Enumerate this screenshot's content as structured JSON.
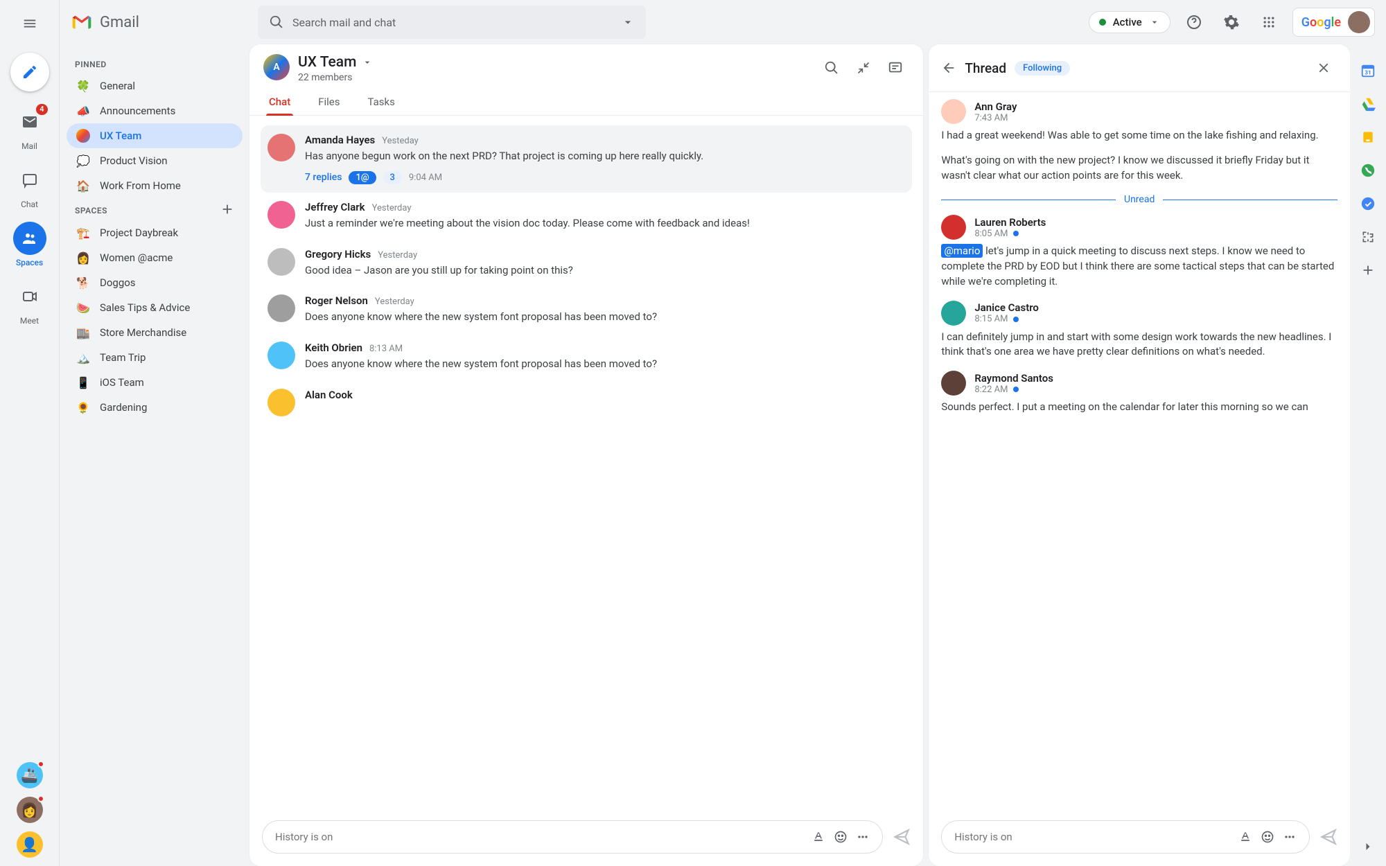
{
  "app": {
    "name": "Gmail",
    "search_placeholder": "Search mail and chat",
    "status": "Active"
  },
  "rail": {
    "mail": "Mail",
    "chat": "Chat",
    "spaces": "Spaces",
    "meet": "Meet",
    "mail_badge": "4"
  },
  "sidebar": {
    "h_pinned": "PINNED",
    "h_spaces": "SPACES",
    "pinned": [
      {
        "icon": "🍀",
        "label": "General"
      },
      {
        "icon": "📣",
        "label": "Announcements"
      },
      {
        "icon": "A",
        "label": "UX Team",
        "active": true,
        "space": true
      },
      {
        "icon": "💭",
        "label": "Product Vision"
      },
      {
        "icon": "🏠",
        "label": "Work From Home"
      }
    ],
    "spaces": [
      {
        "icon": "🏗️",
        "label": "Project Daybreak"
      },
      {
        "icon": "👩",
        "label": "Women @acme"
      },
      {
        "icon": "🐕",
        "label": "Doggos"
      },
      {
        "icon": "🍉",
        "label": "Sales Tips & Advice"
      },
      {
        "icon": "🏬",
        "label": "Store Merchandise"
      },
      {
        "icon": "🏔️",
        "label": "Team Trip"
      },
      {
        "icon": "📱",
        "label": "iOS Team"
      },
      {
        "icon": "🌻",
        "label": "Gardening"
      }
    ]
  },
  "space": {
    "name": "UX Team",
    "members": "22 members",
    "tabs": [
      "Chat",
      "Files",
      "Tasks"
    ]
  },
  "messages": [
    {
      "name": "Amanda Hayes",
      "time": "Yesteday",
      "text": "Has anyone begun work on the next PRD? That project is coming up here really quickly.",
      "hl": true,
      "replies": "7 replies",
      "pill1": "1@",
      "pill2": "3",
      "rtime": "9:04 AM",
      "color": "#e57373"
    },
    {
      "name": "Jeffrey Clark",
      "time": "Yesterday",
      "text": "Just a reminder we're meeting about the vision doc today. Please come with feedback and ideas!",
      "color": "#f06292"
    },
    {
      "name": "Gregory Hicks",
      "time": "Yesterday",
      "text": "Good idea – Jason are you still up for taking point on this?",
      "color": "#bdbdbd"
    },
    {
      "name": "Roger Nelson",
      "time": "Yesterday",
      "text": "Does anyone know where the new system font proposal has been moved to?",
      "color": "#9e9e9e"
    },
    {
      "name": "Keith Obrien",
      "time": "8:13 AM",
      "text": "Does anyone know where the new system font proposal has been moved to?",
      "color": "#4fc3f7"
    },
    {
      "name": "Alan Cook",
      "time": "",
      "text": "",
      "partial": true,
      "color": "#fbc02d"
    }
  ],
  "compose_placeholder": "History is on",
  "thread": {
    "title": "Thread",
    "following": "Following",
    "unread": "Unread",
    "items": [
      {
        "name": "Ann Gray",
        "time": "7:43 AM",
        "dot": false,
        "text": "I had a great weekend! Was able to get some time on the lake fishing and relaxing.",
        "text2": "What's going on with the new project? I know we discussed it briefly Friday but it wasn't clear what our action points are for this week.",
        "color": "#ffccbc"
      },
      {
        "divider": true
      },
      {
        "name": "Lauren Roberts",
        "time": "8:05 AM",
        "dot": true,
        "mention": "@mario",
        "text": " let's jump in a quick meeting to discuss next steps. I know we need to complete the PRD by EOD but I think there are some tactical steps that can be started while we're completing it.",
        "color": "#d32f2f"
      },
      {
        "name": "Janice Castro",
        "time": "8:15 AM",
        "dot": true,
        "text": "I can definitely jump in and start with some design work towards the new headlines. I think that's one area we have pretty clear definitions on what's needed.",
        "color": "#26a69a"
      },
      {
        "name": "Raymond Santos",
        "time": "8:22 AM",
        "dot": true,
        "text": "Sounds perfect. I put a meeting on the calendar for later this morning so we can",
        "color": "#5d4037"
      }
    ]
  },
  "google": "Google"
}
